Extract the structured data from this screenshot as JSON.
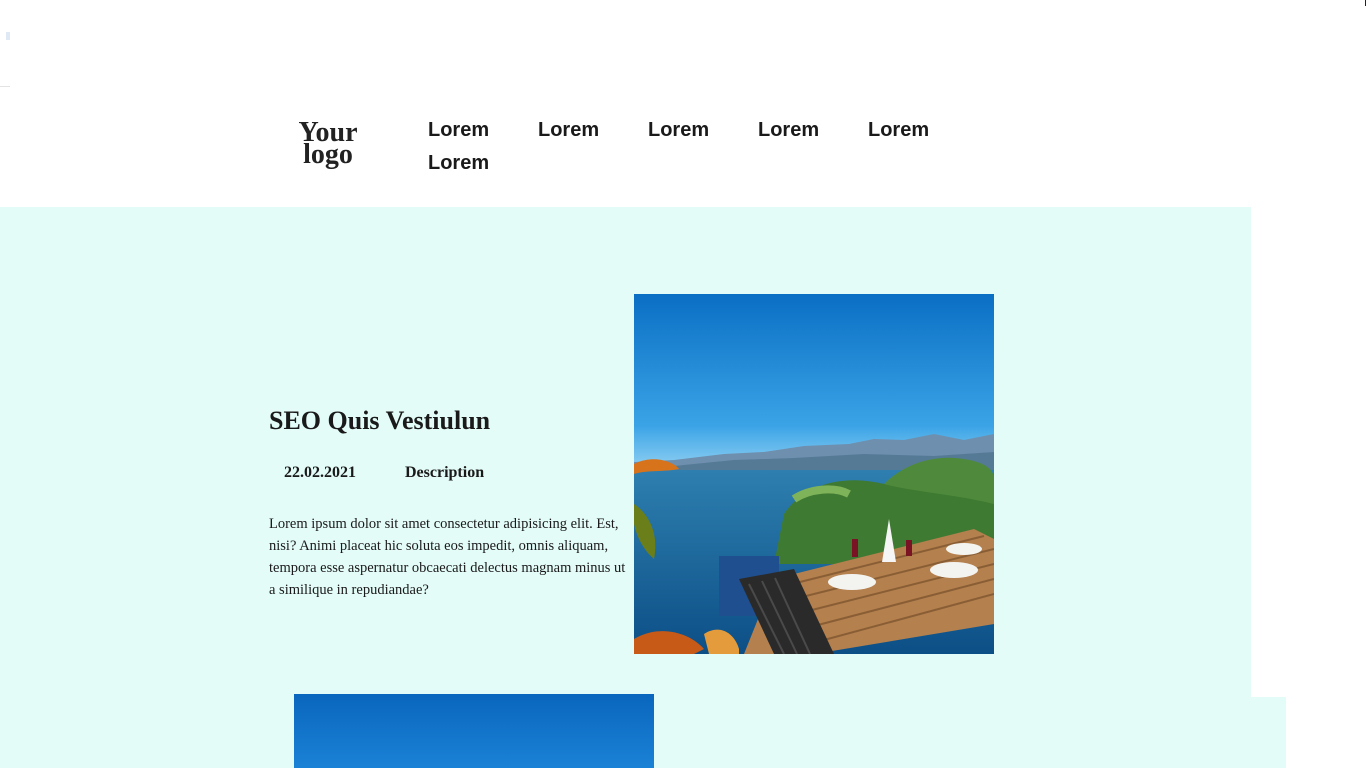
{
  "header": {
    "logo_line1": "Your",
    "logo_line2": "logo",
    "nav": [
      "Lorem",
      "Lorem",
      "Lorem",
      "Lorem",
      "Lorem",
      "Lorem"
    ]
  },
  "post": {
    "title": "SEO Quis Vestiulun",
    "date": "22.02.2021",
    "description_label": "Description",
    "body": "Lorem ipsum dolor sit amet consectetur adipisicing elit. Est, nisi? Animi placeat hic soluta eos impedit, omnis aliquam, tempora esse aspernatur obcaecati delectus magnam minus ut a similique in repudiandae?",
    "image_icon": "seaside-terrace-photo"
  },
  "second_post": {
    "image_icon": "sky-photo"
  },
  "colors": {
    "section_background": "#e3fcf8",
    "text": "#1a1a1a",
    "sky": "#0a6fc4"
  }
}
